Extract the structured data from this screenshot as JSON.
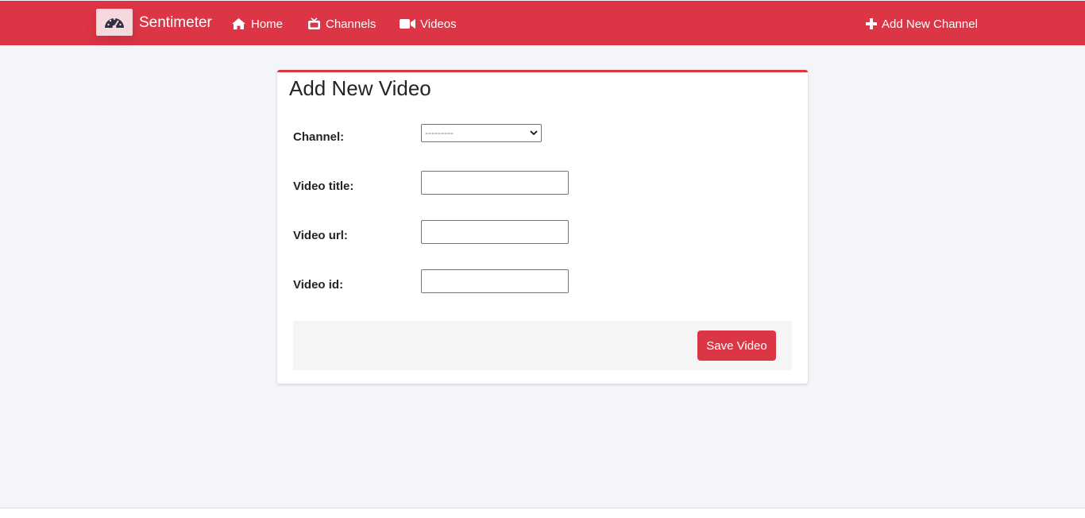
{
  "navbar": {
    "brand": "Sentimeter",
    "brand_icon": "speedometer-icon",
    "links": [
      {
        "label": "Home",
        "icon": "home-icon"
      },
      {
        "label": "Channels",
        "icon": "tv-icon"
      },
      {
        "label": "Videos",
        "icon": "video-camera-icon"
      }
    ],
    "add_channel": {
      "label": "Add New Channel",
      "icon": "plus-icon"
    },
    "color": "#dc3545"
  },
  "form": {
    "title": "Add New Video",
    "channel": {
      "label": "Channel:",
      "selected": "---------"
    },
    "video_title": {
      "label": "Video title:",
      "value": ""
    },
    "video_url": {
      "label": "Video url:",
      "value": ""
    },
    "video_id": {
      "label": "Video id:",
      "value": ""
    },
    "save_label": "Save Video"
  }
}
